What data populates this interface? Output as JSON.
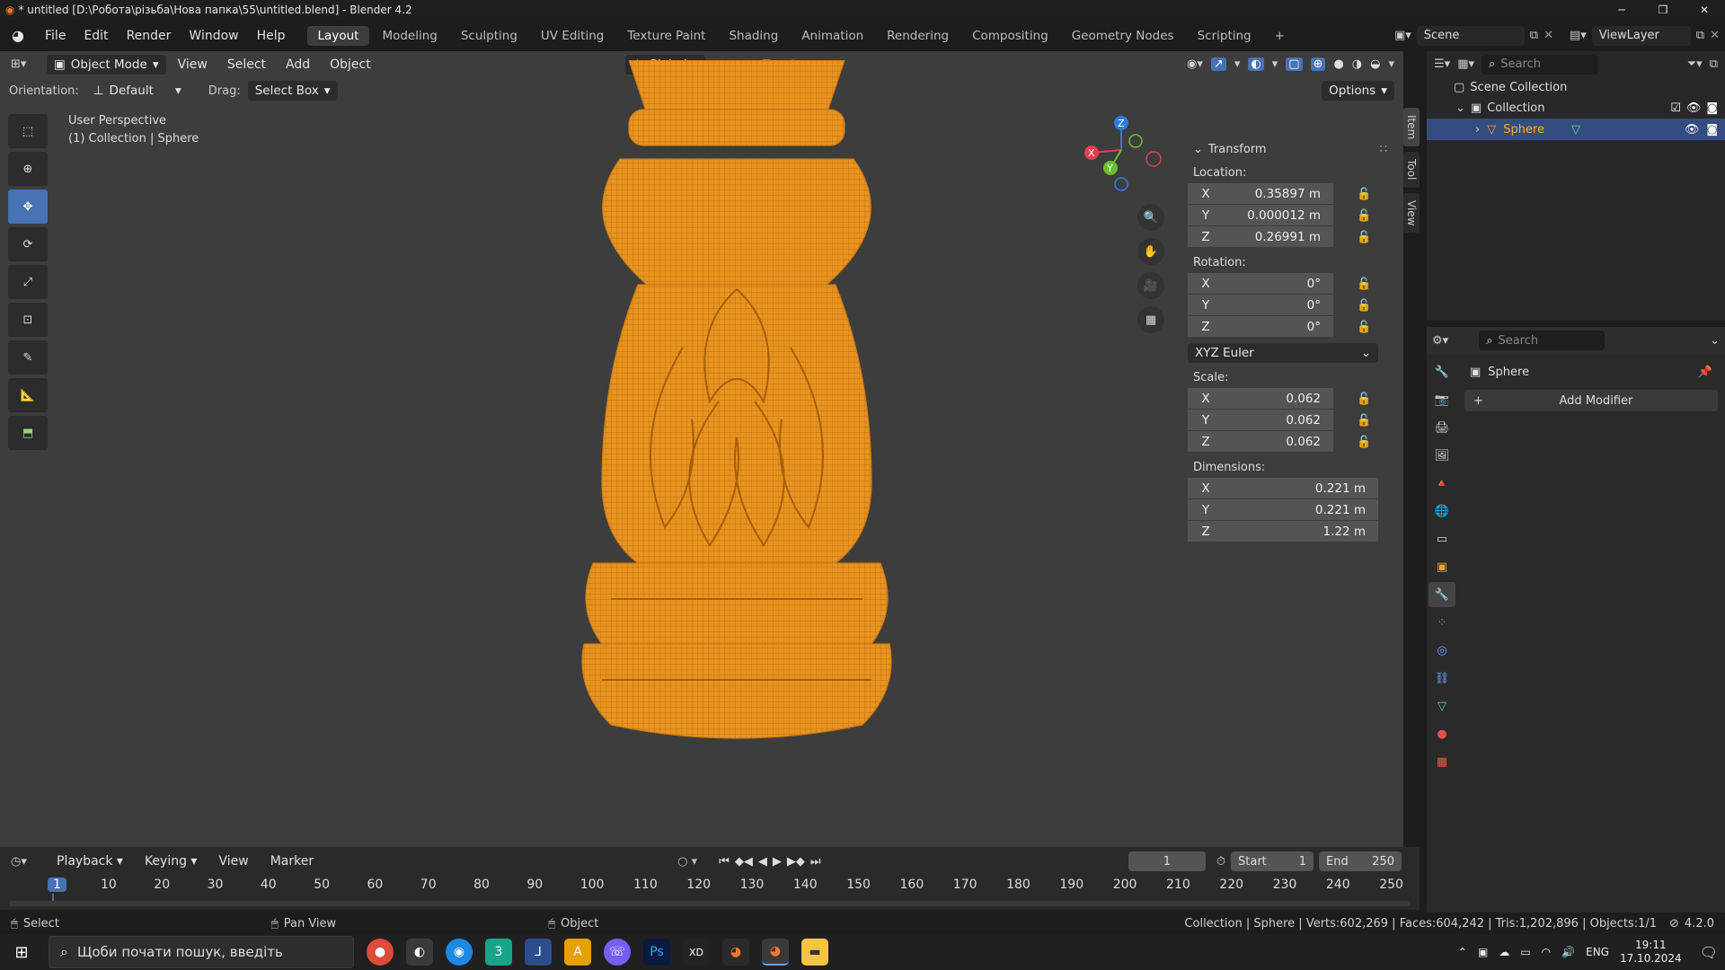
{
  "window": {
    "title": "* untitled [D:\\Робота\\різьба\\Нова папка\\55\\untitled.blend] - Blender 4.2"
  },
  "menu": [
    "File",
    "Edit",
    "Render",
    "Window",
    "Help"
  ],
  "workspaces": [
    "Layout",
    "Modeling",
    "Sculpting",
    "UV Editing",
    "Texture Paint",
    "Shading",
    "Animation",
    "Rendering",
    "Compositing",
    "Geometry Nodes",
    "Scripting"
  ],
  "scene": {
    "name": "Scene",
    "view_layer": "ViewLayer"
  },
  "viewport": {
    "mode": "Object Mode",
    "menus": [
      "View",
      "Select",
      "Add",
      "Object"
    ],
    "transform_orientation": "Global",
    "orientation_label": "Orientation:",
    "orientation_value": "Default",
    "drag_label": "Drag:",
    "drag_value": "Select Box",
    "options_label": "Options",
    "overlay_line1": "User Perspective",
    "overlay_line2": "(1) Collection | Sphere",
    "gizmo": {
      "x": "X",
      "y": "Y",
      "z": "Z"
    }
  },
  "npanel": {
    "tabs": [
      "Item",
      "Tool",
      "View"
    ],
    "section": "Transform",
    "location_label": "Location:",
    "location": {
      "x": "0.35897 m",
      "y": "0.000012 m",
      "z": "0.26991 m"
    },
    "rotation_label": "Rotation:",
    "rotation": {
      "x": "0°",
      "y": "0°",
      "z": "0°"
    },
    "rotation_mode": "XYZ Euler",
    "scale_label": "Scale:",
    "scale": {
      "x": "0.062",
      "y": "0.062",
      "z": "0.062"
    },
    "dimensions_label": "Dimensions:",
    "dimensions": {
      "x": "0.221 m",
      "y": "0.221 m",
      "z": "1.22 m"
    },
    "axis": {
      "x": "X",
      "y": "Y",
      "z": "Z"
    }
  },
  "outliner": {
    "search_placeholder": "Search",
    "scene_collection": "Scene Collection",
    "collection": "Collection",
    "object": "Sphere"
  },
  "properties": {
    "search_placeholder": "Search",
    "object_name": "Sphere",
    "add_modifier": "Add Modifier"
  },
  "timeline": {
    "menus": [
      "Playback",
      "Keying",
      "View",
      "Marker"
    ],
    "current_frame": "1",
    "start_label": "Start",
    "start": "1",
    "end_label": "End",
    "end": "250",
    "ticks": [
      "1",
      "10",
      "20",
      "30",
      "40",
      "50",
      "60",
      "70",
      "80",
      "90",
      "100",
      "110",
      "120",
      "130",
      "140",
      "150",
      "160",
      "170",
      "180",
      "190",
      "200",
      "210",
      "220",
      "230",
      "240",
      "250"
    ]
  },
  "statusbar": {
    "select": "Select",
    "pan_view": "Pan View",
    "object": "Object",
    "stats": "Collection | Sphere | Verts:602,269 | Faces:604,242 | Tris:1,202,896 | Objects:1/1",
    "version": "4.2.0"
  },
  "taskbar": {
    "search_placeholder": "Щоби почати пошук, введіть",
    "lang": "ENG",
    "time": "19:11",
    "date": "17.10.2024"
  },
  "colors": {
    "accent": "#4772b3",
    "mesh": "#f0a030",
    "viewport_bg": "#3d3d3d"
  }
}
